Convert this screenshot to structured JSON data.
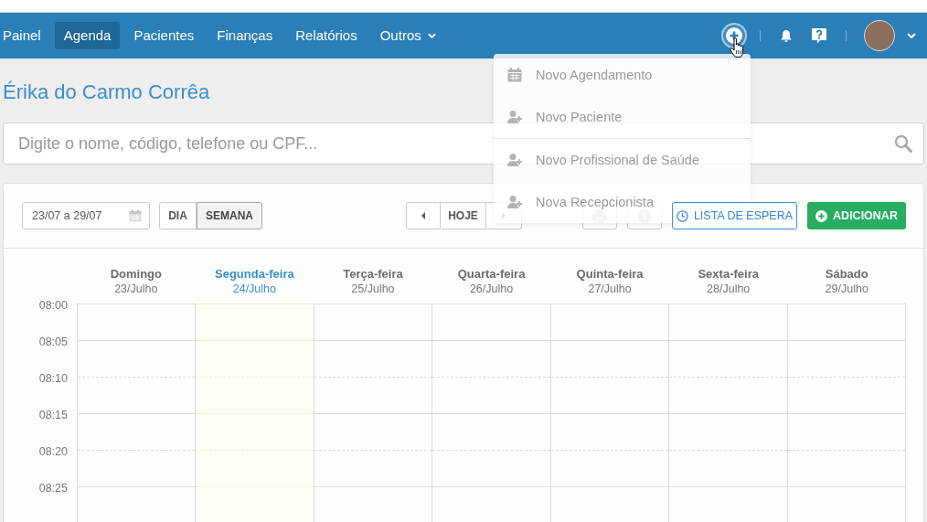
{
  "nav": {
    "items": [
      {
        "label": "Painel",
        "selected": false,
        "kind": "link"
      },
      {
        "label": "Agenda",
        "selected": true,
        "kind": "link"
      },
      {
        "label": "Pacientes",
        "selected": false,
        "kind": "link"
      },
      {
        "label": "Finanças",
        "selected": false,
        "kind": "link"
      },
      {
        "label": "Relatórios",
        "selected": false,
        "kind": "link"
      },
      {
        "label": "Outros",
        "selected": false,
        "kind": "dropdown"
      }
    ]
  },
  "quick_add_menu": {
    "open": true,
    "groups": [
      {
        "items": [
          {
            "label": "Novo Agendamento",
            "kind": "appointment"
          },
          {
            "label": "Novo Paciente",
            "kind": "person"
          }
        ]
      },
      {
        "items": [
          {
            "label": "Novo Profissional de Saúde",
            "kind": "person"
          },
          {
            "label": "Nova Recepcionista",
            "kind": "person"
          }
        ]
      }
    ]
  },
  "page_title": "Érika do Carmo Corrêa",
  "search": {
    "placeholder": "Digite o nome, código, telefone ou CPF..."
  },
  "toolbar": {
    "date_range": "23/07 a 29/07",
    "view_modes": [
      {
        "label": "DIA",
        "selected": false
      },
      {
        "label": "SEMANA",
        "selected": true
      }
    ],
    "today_button": "HOJE",
    "waitlist_button": "LISTA DE ESPERA",
    "add_button": "ADICIONAR"
  },
  "calendar": {
    "days": [
      {
        "name": "Domingo",
        "date": "23/Julho",
        "today": false
      },
      {
        "name": "Segunda-feira",
        "date": "24/Julho",
        "today": true
      },
      {
        "name": "Terça-feira",
        "date": "25/Julho",
        "today": false
      },
      {
        "name": "Quarta-feira",
        "date": "26/Julho",
        "today": false
      },
      {
        "name": "Quinta-feira",
        "date": "27/Julho",
        "today": false
      },
      {
        "name": "Sexta-feira",
        "date": "28/Julho",
        "today": false
      },
      {
        "name": "Sábado",
        "date": "29/Julho",
        "today": false
      }
    ],
    "times": [
      "08:00",
      "08:05",
      "08:10",
      "08:15",
      "08:20",
      "08:25"
    ]
  }
}
